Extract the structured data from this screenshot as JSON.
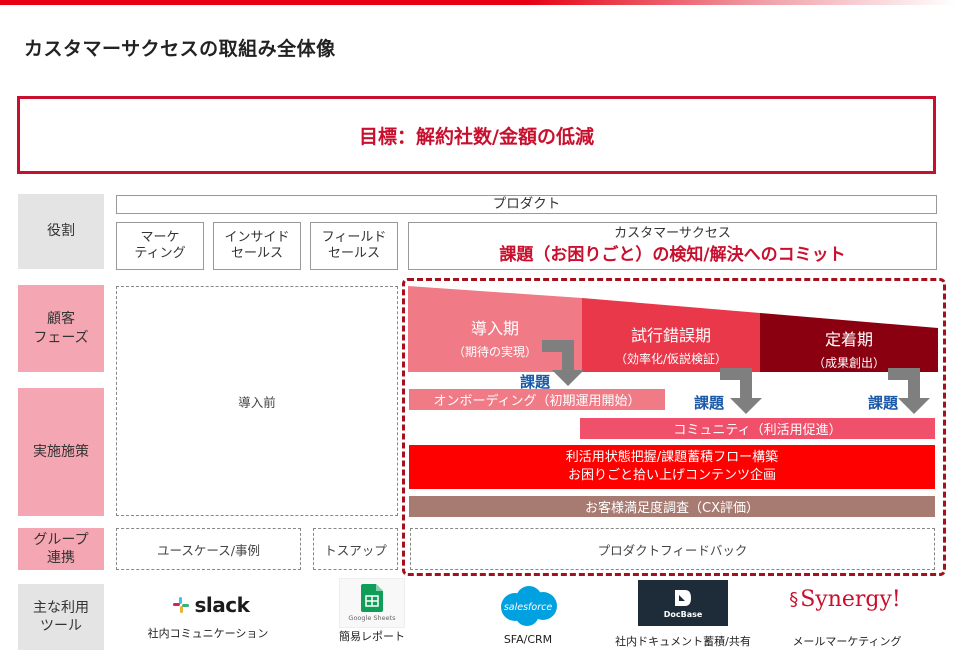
{
  "header": {
    "title": "カスタマーサクセスの取組み全体像"
  },
  "goal": {
    "text": "目標：解約社数/金額の低減"
  },
  "rows": {
    "role": "役割",
    "phase": "顧客\nフェーズ",
    "measures": "実施施策",
    "group": "グループ\n連携",
    "tools": "主な利用\nツール"
  },
  "roles": {
    "product": "プロダクト",
    "marketing": "マーケ\nティング",
    "inside_sales": "インサイド\nセールス",
    "field_sales": "フィールド\nセールス",
    "cs_sub": "カスタマーサクセス",
    "cs_main": "課題（お困りごと）の検知/解決へのコミット"
  },
  "pre_intro": "導入前",
  "phases": [
    {
      "name": "導入期",
      "sub": "（期待の実現）",
      "color": "#f07b86"
    },
    {
      "name": "試行錯誤期",
      "sub": "（効率化/仮説検証）",
      "color": "#e8384a"
    },
    {
      "name": "定着期",
      "sub": "（成果創出）",
      "color": "#8b0010"
    }
  ],
  "kadai_label": "課題",
  "measures": {
    "onboarding": "オンボーディング（初期運用開始）",
    "community": "コミュニティ（利活用促進）",
    "flow_line1": "利活用状態把握/課題蓄積フロー構築",
    "flow_line2": "お困りごと拾い上げコンテンツ企画",
    "survey": "お客様満足度調査（CX評価）"
  },
  "group": {
    "usecase": "ユースケース/事例",
    "toss_up": "トスアップ",
    "feedback": "プロダクトフィードバック"
  },
  "tools": [
    {
      "logo": "slack",
      "label": "社内コミュニケーション"
    },
    {
      "logo": "Google Sheets",
      "label": "簡易レポート"
    },
    {
      "logo": "salesforce",
      "label": "SFA/CRM"
    },
    {
      "logo": "DocBase",
      "label": "社内ドキュメント蓄積/共有"
    },
    {
      "logo": "Synergy!",
      "label": "メールマーケティング"
    }
  ],
  "colors": {
    "accent": "#c8102e",
    "pink_label": "#f4a6b2",
    "gray_label": "#e4e4e4",
    "kadai_blue": "#1a5aa8",
    "onboarding_bar": "#f07b86",
    "community_bar": "#f0506a",
    "flow_bar": "#ff0000",
    "survey_bar": "#a87b72"
  }
}
